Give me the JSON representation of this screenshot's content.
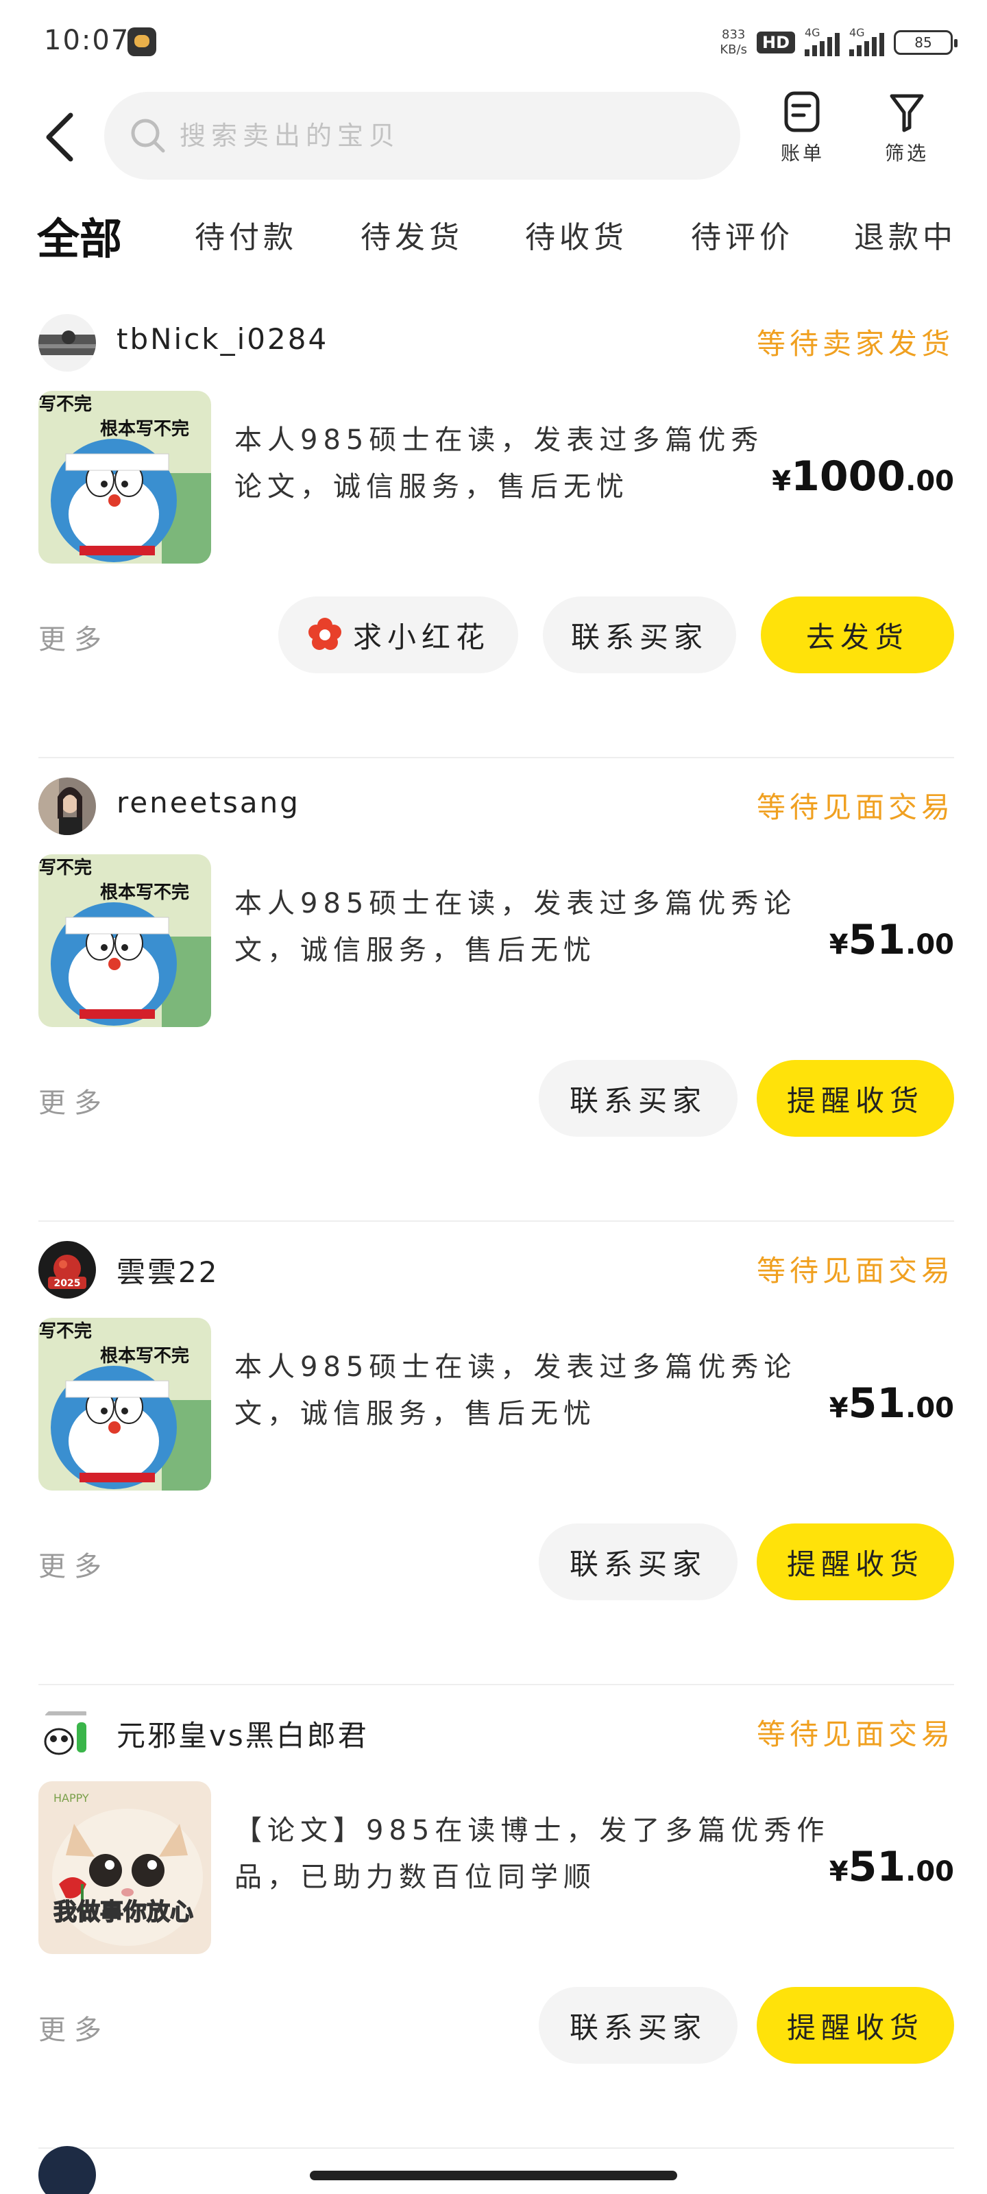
{
  "status_bar": {
    "time": "10:07",
    "net_speed_value": "833",
    "net_speed_unit": "KB/s",
    "hd": "HD",
    "signal1": "4G",
    "signal2": "4G",
    "battery": "85"
  },
  "header": {
    "search_placeholder": "搜索卖出的宝贝",
    "bill_label": "账单",
    "filter_label": "筛选"
  },
  "tabs": [
    {
      "label": "全部",
      "active": true
    },
    {
      "label": "待付款"
    },
    {
      "label": "待发货"
    },
    {
      "label": "待收货"
    },
    {
      "label": "待评价"
    },
    {
      "label": "退款中"
    }
  ],
  "orders": [
    {
      "username": "tbNick_i0284",
      "status": "等待卖家发货",
      "thumb_text_1": "写不完",
      "thumb_text_2": "根本写不完",
      "title": "本人985硕士在读，发表过多篇优秀论文，诚信服务，售后无忧",
      "price_currency": "¥",
      "price_int": "1000",
      "price_dec": ".00",
      "more": "更多",
      "btn_flower": "求小红花",
      "btn_contact": "联系买家",
      "btn_primary": "去发货"
    },
    {
      "username": "reneetsang",
      "status": "等待见面交易",
      "thumb_text_1": "写不完",
      "thumb_text_2": "根本写不完",
      "title": "本人985硕士在读，发表过多篇优秀论文，诚信服务，售后无忧",
      "price_currency": "¥",
      "price_int": "51",
      "price_dec": ".00",
      "more": "更多",
      "btn_contact": "联系买家",
      "btn_primary": "提醒收货"
    },
    {
      "username": "雲雲22",
      "avatar_text": "2025",
      "status": "等待见面交易",
      "thumb_text_1": "写不完",
      "thumb_text_2": "根本写不完",
      "title": "本人985硕士在读，发表过多篇优秀论文，诚信服务，售后无忧",
      "price_currency": "¥",
      "price_int": "51",
      "price_dec": ".00",
      "more": "更多",
      "btn_contact": "联系买家",
      "btn_primary": "提醒收货"
    },
    {
      "username": "元邪皇vs黑白郎君",
      "status": "等待见面交易",
      "thumb_text_1": "我做事你放心",
      "title": "【论文】985在读博士，发了多篇优秀作品，已助力数百位同学顺",
      "price_currency": "¥",
      "price_int": "51",
      "price_dec": ".00",
      "more": "更多",
      "btn_contact": "联系买家",
      "btn_primary": "提醒收货"
    }
  ],
  "colors": {
    "accent_yellow": "#ffe20a",
    "status_orange": "#f0a020",
    "flower_red": "#e8402a"
  }
}
